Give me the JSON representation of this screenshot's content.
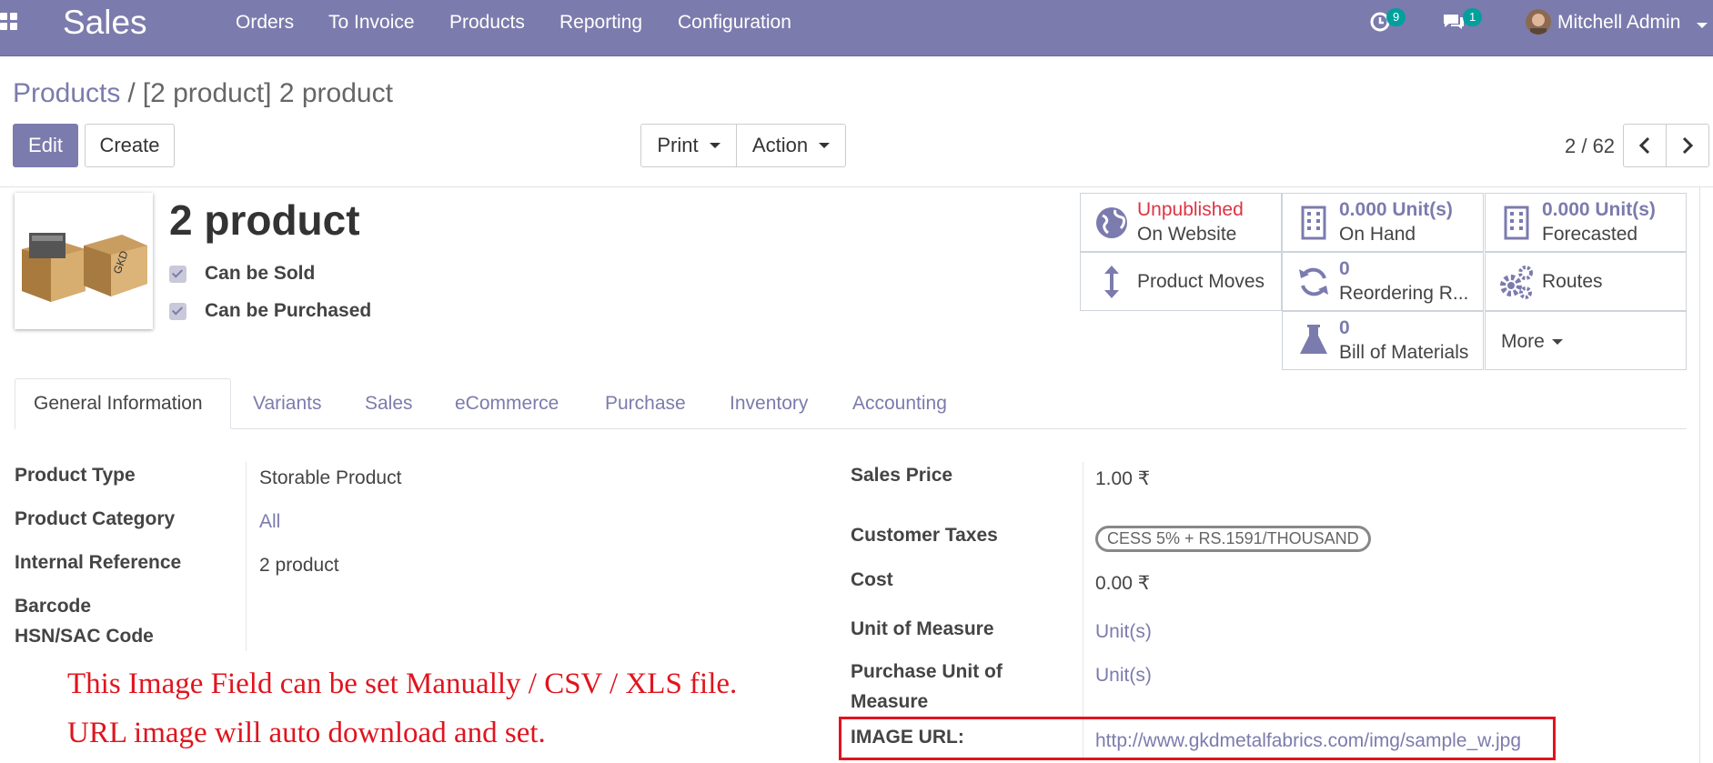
{
  "navbar": {
    "app_name": "Sales",
    "menu": [
      "Orders",
      "To Invoice",
      "Products",
      "Reporting",
      "Configuration"
    ],
    "activity_count": "9",
    "message_count": "1",
    "user_name": "Mitchell Admin",
    "bg_color": "#7c7bad",
    "badge_color": "#00a09d"
  },
  "breadcrumb": {
    "parent": "Products",
    "separator": "/",
    "current": "[2 product] 2 product"
  },
  "buttons": {
    "edit": "Edit",
    "create": "Create",
    "print": "Print",
    "action": "Action"
  },
  "pager": {
    "value": "2 / 62"
  },
  "product": {
    "name": "2 product",
    "can_be_sold": "Can be Sold",
    "can_be_purchased": "Can be Purchased",
    "image_icon": "product-boxes-image"
  },
  "smart_buttons": {
    "website_status": "Unpublished",
    "website_label": "On Website",
    "on_hand_value": "0.000 Unit(s)",
    "on_hand_label": "On Hand",
    "forecast_value": "0.000 Unit(s)",
    "forecast_label": "Forecasted",
    "moves_label": "Product Moves",
    "reorder_value": "0",
    "reorder_label": "Reordering R...",
    "routes_label": "Routes",
    "bom_value": "0",
    "bom_label": "Bill of Materials",
    "more_label": "More"
  },
  "tabs": [
    "General Information",
    "Variants",
    "Sales",
    "eCommerce",
    "Purchase",
    "Inventory",
    "Accounting"
  ],
  "left_fields": {
    "product_type_label": "Product Type",
    "product_type_value": "Storable Product",
    "category_label": "Product Category",
    "category_value": "All",
    "internal_ref_label": "Internal Reference",
    "internal_ref_value": "2 product",
    "barcode_label": "Barcode",
    "hsn_label": "HSN/SAC Code"
  },
  "right_fields": {
    "sales_price_label": "Sales Price",
    "sales_price_value": "1.00 ₹",
    "taxes_label": "Customer Taxes",
    "taxes_tag": "CESS 5% + RS.1591/THOUSAND",
    "cost_label": "Cost",
    "cost_value": "0.00 ₹",
    "uom_label": "Unit of Measure",
    "uom_value": "Unit(s)",
    "purchase_uom_label_1": "Purchase Unit of",
    "purchase_uom_label_2": "Measure",
    "purchase_uom_value": "Unit(s)",
    "image_url_label": "IMAGE URL:",
    "image_url_value": "http://www.gkdmetalfabrics.com/img/sample_w.jpg"
  },
  "annotation": {
    "line1": "This Image Field can be set Manually / CSV / XLS file.",
    "line2": "URL image will auto download and set.",
    "color": "#e0141e"
  }
}
